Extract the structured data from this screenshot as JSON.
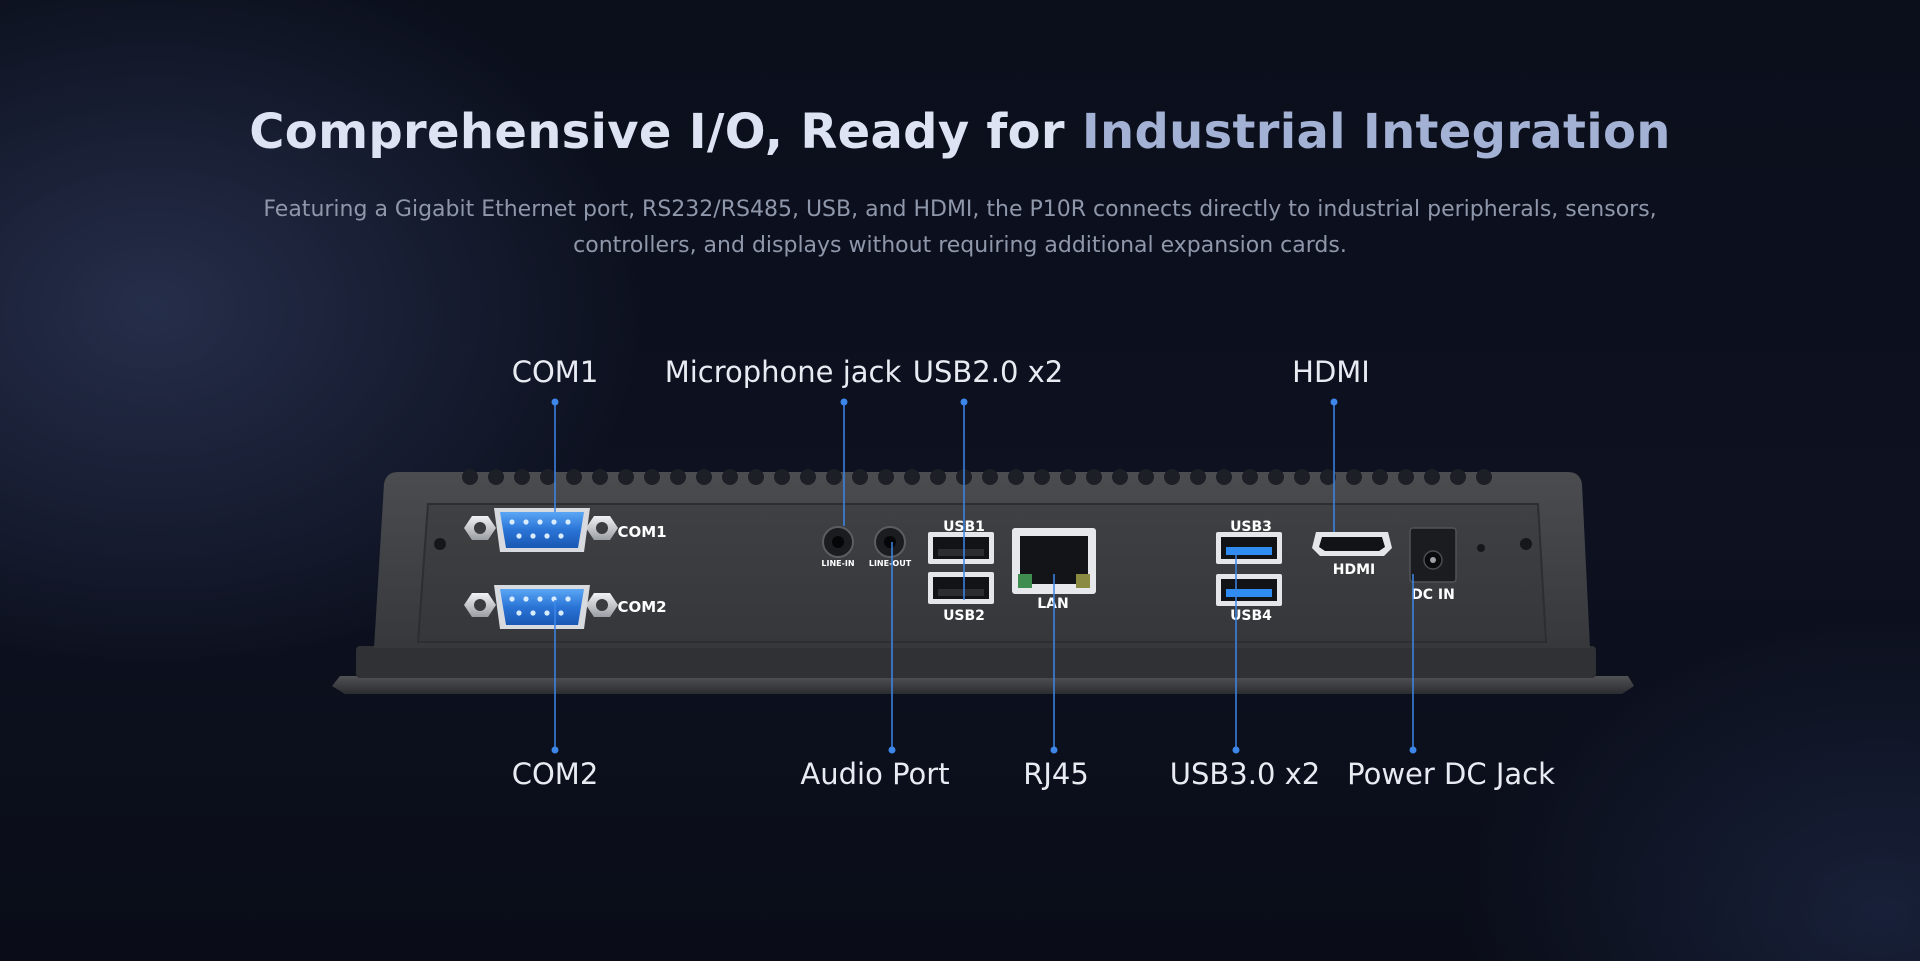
{
  "header": {
    "title_main": "Comprehensive I/O, Ready for ",
    "title_accent": "Industrial Integration",
    "subtitle": "Featuring a Gigabit Ethernet port, RS232/RS485, USB, and HDMI, the P10R connects directly to industrial peripherals, sensors, controllers, and displays without requiring additional expansion cards."
  },
  "callouts": {
    "com1": "COM1",
    "microphone": "Microphone jack",
    "usb2": "USB2.0 x2",
    "hdmi": "HDMI",
    "com2": "COM2",
    "audio": "Audio Port",
    "rj45": "RJ45",
    "usb3": "USB3.0 x2",
    "power": "Power DC Jack"
  },
  "port_labels": {
    "com1": "COM1",
    "com2": "COM2",
    "line_in": "LINE-IN",
    "line_out": "LINE-OUT",
    "usb1": "USB1",
    "usb2": "USB2",
    "lan": "LAN",
    "usb3": "USB3",
    "usb4": "USB4",
    "hdmi": "HDMI",
    "dc_in": "DC IN"
  },
  "colors": {
    "accent_line": "#3d86ea",
    "port_blue": "#2f78d8",
    "chassis": "#3b3d40"
  }
}
